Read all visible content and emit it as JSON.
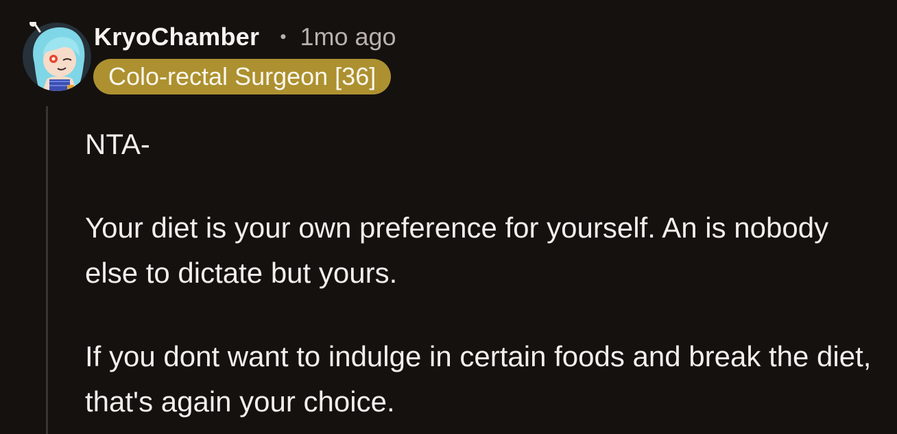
{
  "comment": {
    "username": "KryoChamber",
    "separator": "•",
    "timestamp": "1mo ago",
    "flair": "Colo-rectal Surgeon [36]",
    "avatar_icon": "user-avatar-icon",
    "paragraphs": [
      "NTA-",
      "Your diet is your own preference for yourself. An is nobody else to dictate but yours.",
      "If you dont want to indulge in certain foods and break the diet, that's again your choice."
    ]
  },
  "colors": {
    "background": "#15110f",
    "flair_background": "#ad9130",
    "username": "#f6f3f0",
    "meta": "#b9b1ac",
    "body": "#f2efec",
    "thread_line": "#3a3532"
  }
}
